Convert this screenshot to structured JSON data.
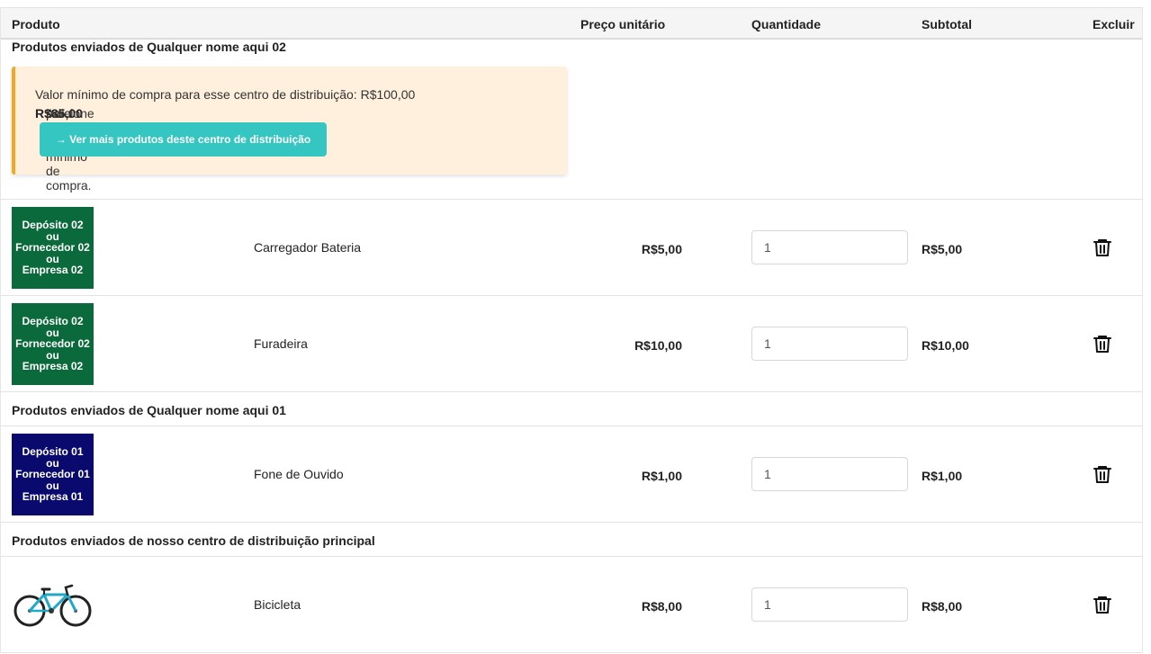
{
  "header": {
    "produto": "Produto",
    "preco": "Preço unitário",
    "quantidade": "Quantidade",
    "subtotal": "Subtotal",
    "excluir": "Excluir"
  },
  "groups": [
    {
      "title": "Produtos enviados de Qualquer nome aqui 02",
      "alert": {
        "line1": "Valor mínimo de compra para esse centro de distribuição: R$100,00",
        "line2_prefix": "Adicione mais ",
        "line2_amount": "R$85,00",
        "line2_suffix": " para atingir o valor mínimo de compra.",
        "button": "→ Ver mais produtos deste centro de distribuição"
      },
      "items": [
        {
          "thumb_text": "Depósito 02\nou\nFornecedor 02\nou\nEmpresa 02",
          "thumb_color": "#0b6a3b",
          "name": "Carregador Bateria",
          "price": "R$5,00",
          "qty": "1",
          "subtotal": "R$5,00"
        },
        {
          "thumb_text": "Depósito 02\nou\nFornecedor 02\nou\nEmpresa 02",
          "thumb_color": "#0b6a3b",
          "name": "Furadeira",
          "price": "R$10,00",
          "qty": "1",
          "subtotal": "R$10,00"
        }
      ]
    },
    {
      "title": "Produtos enviados de Qualquer nome aqui 01",
      "items": [
        {
          "thumb_text": "Depósito 01\nou\nFornecedor 01\nou\nEmpresa 01",
          "thumb_color": "#0a0a6e",
          "name": "Fone de Ouvido",
          "price": "R$1,00",
          "qty": "1",
          "subtotal": "R$1,00"
        }
      ]
    },
    {
      "title": "Produtos enviados de nosso centro de distribuição principal",
      "items": [
        {
          "thumb_icon": "bicycle-image",
          "name": "Bicicleta",
          "price": "R$8,00",
          "qty": "1",
          "subtotal": "R$8,00"
        }
      ]
    }
  ],
  "icons": {
    "delete": "trash-icon"
  }
}
